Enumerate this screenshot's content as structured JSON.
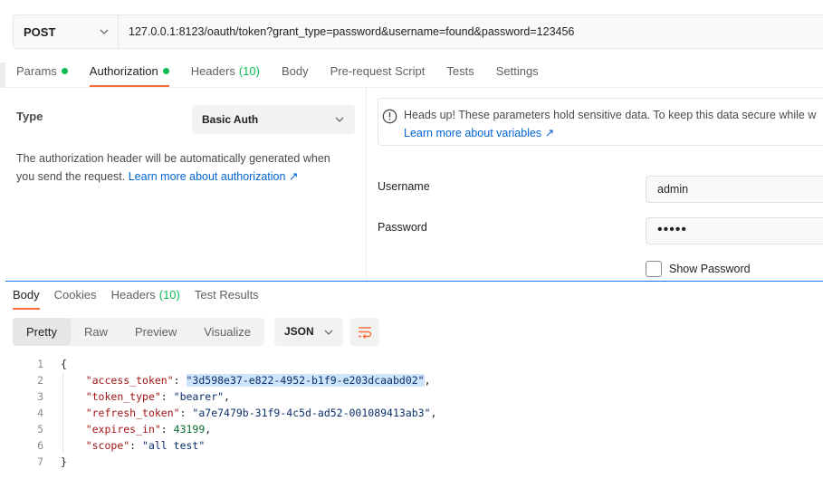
{
  "request": {
    "method": "POST",
    "url": "127.0.0.1:8123/oauth/token?grant_type=password&username=found&password=123456"
  },
  "request_tabs": [
    {
      "label": "Params",
      "dot": true
    },
    {
      "label": "Authorization",
      "dot": true,
      "active": true
    },
    {
      "label": "Headers",
      "count": "(10)"
    },
    {
      "label": "Body"
    },
    {
      "label": "Pre-request Script"
    },
    {
      "label": "Tests"
    },
    {
      "label": "Settings"
    }
  ],
  "auth": {
    "type_label": "Type",
    "type_value": "Basic Auth",
    "description": "The authorization header will be automatically generated when you send the request.",
    "description_link": "Learn more about authorization ↗",
    "notice_text": "Heads up! These parameters hold sensitive data. To keep this data secure while w",
    "notice_link": "Learn more about variables ↗",
    "username_label": "Username",
    "username_value": "admin",
    "password_label": "Password",
    "password_value": "•••••",
    "show_password_label": "Show Password"
  },
  "response_tabs": [
    {
      "label": "Body",
      "active": true
    },
    {
      "label": "Cookies"
    },
    {
      "label": "Headers",
      "count": "(10)"
    },
    {
      "label": "Test Results"
    }
  ],
  "view_modes": [
    "Pretty",
    "Raw",
    "Preview",
    "Visualize"
  ],
  "active_view": "Pretty",
  "format": "JSON",
  "code_lines": [
    {
      "n": "1",
      "text": "{"
    },
    {
      "n": "2",
      "key": "\"access_token\"",
      "value": "\"3d598e37-e822-4952-b1f9-e203dcaabd02\"",
      "vtype": "s",
      "highlight": true,
      "trail": ","
    },
    {
      "n": "3",
      "key": "\"token_type\"",
      "value": "\"bearer\"",
      "vtype": "s",
      "trail": ","
    },
    {
      "n": "4",
      "key": "\"refresh_token\"",
      "value": "\"a7e7479b-31f9-4c5d-ad52-001089413ab3\"",
      "vtype": "s",
      "trail": ","
    },
    {
      "n": "5",
      "key": "\"expires_in\"",
      "value": "43199",
      "vtype": "num",
      "trail": ","
    },
    {
      "n": "6",
      "key": "\"scope\"",
      "value": "\"all test\"",
      "vtype": "s",
      "trail": ""
    },
    {
      "n": "7",
      "text": "}"
    }
  ],
  "colors": {
    "accent_orange": "#ff6c37",
    "status_green": "#0cbb52",
    "link_blue": "#0265d2"
  },
  "icons": {
    "method_chevron": "chevron-down-icon",
    "notice": "info-icon",
    "wrap": "wrap-lines-icon"
  }
}
